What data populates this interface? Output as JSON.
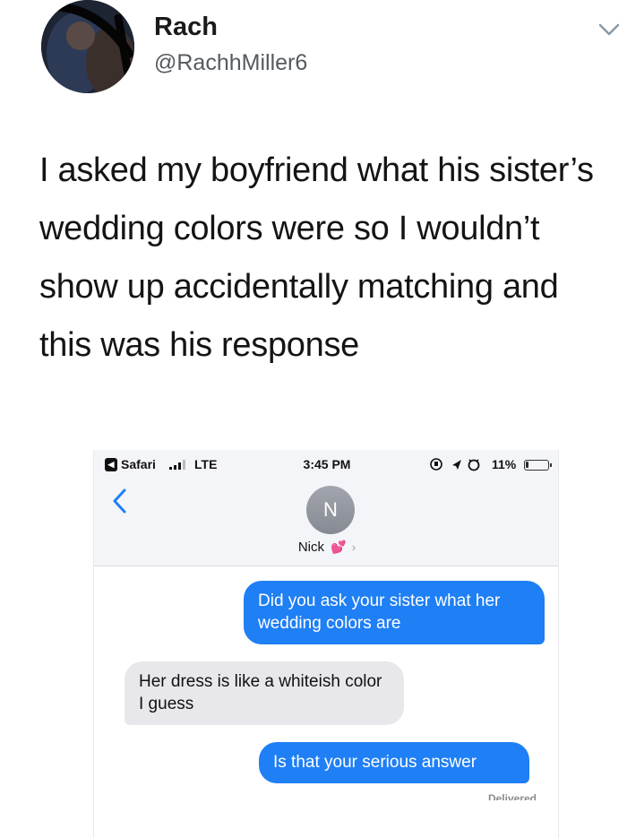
{
  "tweet": {
    "author_name": "Rach",
    "author_handle": "@RachhMiller6",
    "text": "I asked my boyfriend what his sister’s wedding colors were so I wouldn’t show up accidentally matching and this was his response",
    "avatar_icon": "profile-photo",
    "menu_icon": "chevron-down-icon"
  },
  "embedded_screenshot": {
    "status_bar": {
      "back_app": "Safari",
      "network": "LTE",
      "time": "3:45 PM",
      "battery": "11%",
      "battery_level": 0.11
    },
    "contact": {
      "initial": "N",
      "name": "Nick",
      "emoji": "💕",
      "chevron": "›"
    },
    "messages": [
      {
        "direction": "outgoing",
        "text": "Did you ask your sister what her wedding colors are"
      },
      {
        "direction": "incoming",
        "text": "Her dress is like a whiteish color I guess"
      },
      {
        "direction": "outgoing",
        "text": "Is that your serious answer"
      }
    ],
    "delivery_status": "Delivered",
    "colors": {
      "outgoing_bubble": "#1f7ff5",
      "incoming_bubble": "#e8e8ec",
      "header_bg": "#f4f5f8"
    }
  }
}
